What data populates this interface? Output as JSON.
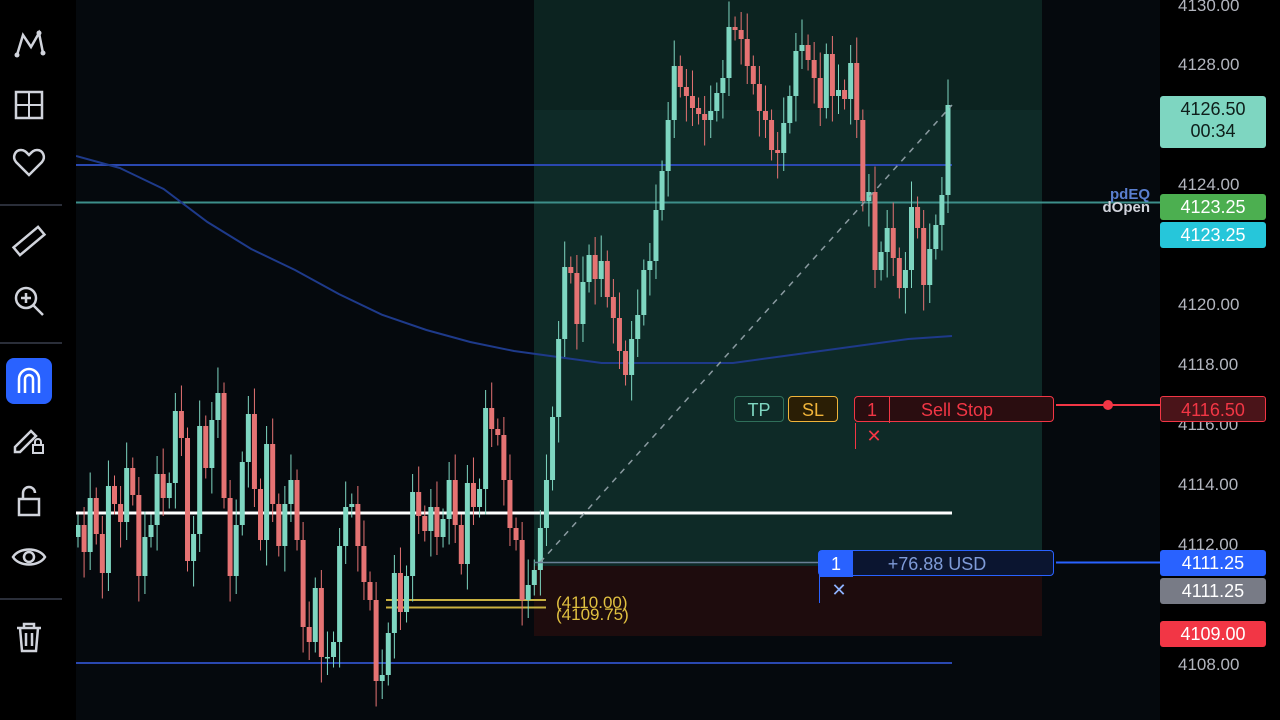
{
  "toolbar": {
    "tools": [
      "pattern-tool-icon",
      "layout-grid-icon",
      "heart-icon",
      "ruler-icon",
      "zoom-in-icon",
      "magnet-icon",
      "pencil-lock-icon",
      "unlock-icon",
      "eye-icon",
      "trash-icon"
    ],
    "active_tool": "magnet-icon"
  },
  "chart_data": {
    "type": "candlestick",
    "ylim": [
      4106.0,
      4130.0
    ],
    "y_ticks": [
      "4130.00",
      "4128.00",
      "4124.00",
      "4120.00",
      "4118.00",
      "4116.00",
      "4114.00",
      "4112.00",
      "4108.00"
    ],
    "close_prices": [
      4112.5,
      4111.6,
      4113.4,
      4112.2,
      4110.9,
      4113.8,
      4113.2,
      4112.6,
      4114.4,
      4113.5,
      4110.8,
      4112.1,
      4112.5,
      4114.2,
      4113.4,
      4113.9,
      4116.3,
      4115.4,
      4111.3,
      4112.2,
      4115.8,
      4114.4,
      4116.0,
      4116.9,
      4113.4,
      4110.8,
      4112.5,
      4114.6,
      4116.2,
      4113.7,
      4112.0,
      4115.2,
      4113.2,
      4111.8,
      4113.2,
      4114.0,
      4112.0,
      4109.1,
      4108.6,
      4110.4,
      4108.1,
      4108.1,
      4108.6,
      4111.8,
      4113.1,
      4113.2,
      4111.8,
      4110.6,
      4110.0,
      4107.3,
      4107.5,
      4108.9,
      4110.9,
      4109.6,
      4110.8,
      4113.6,
      4112.8,
      4112.3,
      4113.1,
      4112.1,
      4112.7,
      4114.0,
      4112.5,
      4111.2,
      4113.9,
      4113.1,
      4113.7,
      4116.4,
      4115.7,
      4115.5,
      4114.0,
      4112.4,
      4112.0,
      4110.0,
      4110.5,
      4111.0,
      4112.4,
      4114.0,
      4116.1,
      4118.7,
      4121.1,
      4120.9,
      4119.2,
      4120.6,
      4121.5,
      4120.7,
      4121.3,
      4120.1,
      4119.4,
      4118.3,
      4117.5,
      4118.7,
      4119.5,
      4121.0,
      4121.3,
      4123.0,
      4124.3,
      4126.0,
      4127.8,
      4127.1,
      4126.8,
      4126.4,
      4126.2,
      4126.0,
      4126.3,
      4126.9,
      4127.4,
      4129.1,
      4129.0,
      4128.7,
      4127.8,
      4127.2,
      4126.3,
      4126.0,
      4125.0,
      4124.9,
      4125.9,
      4126.8,
      4128.3,
      4128.5,
      4128.0,
      4127.4,
      4126.4,
      4128.2,
      4126.8,
      4127.0,
      4126.7,
      4127.9,
      4126.0,
      4123.3,
      4123.6,
      4121.0,
      4121.6,
      4122.4,
      4121.4,
      4120.4,
      4121.0,
      4123.1,
      4122.4,
      4120.5,
      4121.7,
      4122.5,
      4123.5,
      4126.5
    ],
    "lines": [
      {
        "name": "pdEQ",
        "value": 4124.5
      },
      {
        "name": "dOpen",
        "value": 4123.25
      }
    ],
    "horizontal_levels": [
      4112.9,
      4107.9
    ],
    "moving_average": [
      4124.8,
      4124.4,
      4123.7,
      4122.6,
      4121.7,
      4121.0,
      4120.2,
      4119.5,
      4119.0,
      4118.6,
      4118.3,
      4118.1,
      4117.9,
      4117.9,
      4117.9,
      4117.9,
      4118.1,
      4118.3,
      4118.5,
      4118.7,
      4118.8
    ],
    "price_labels": [
      {
        "value": "4126.50",
        "sub": "00:34",
        "color": "#7ed6c1",
        "text_color": "#0e1e1a"
      },
      {
        "value": "4123.25",
        "color": "#4caf50",
        "text_color": "#ffffff"
      },
      {
        "value": "4123.25",
        "color": "#26c6da",
        "text_color": "#ffffff"
      },
      {
        "value": "4116.50",
        "color": "#4a1419",
        "text_color": "#f23645"
      },
      {
        "value": "4111.25",
        "color": "#2962ff",
        "text_color": "#ffffff"
      },
      {
        "value": "4111.25",
        "color": "#787b86",
        "text_color": "#ffffff"
      },
      {
        "value": "4109.00",
        "color": "#f23645",
        "text_color": "#ffffff"
      }
    ],
    "level_annotations": [
      "(4110.00)",
      "(4109.75)"
    ],
    "colors": {
      "up": "#7ed6c1",
      "down": "#e57373",
      "ma": "#1e3a8a",
      "entry": "#6a7f95"
    }
  },
  "order": {
    "tp_label": "TP",
    "sl_label": "SL",
    "qty": "1",
    "type_label": "Sell Stop",
    "close": "✕"
  },
  "position": {
    "qty": "1",
    "pnl": "+76.88 USD",
    "close": "✕"
  }
}
